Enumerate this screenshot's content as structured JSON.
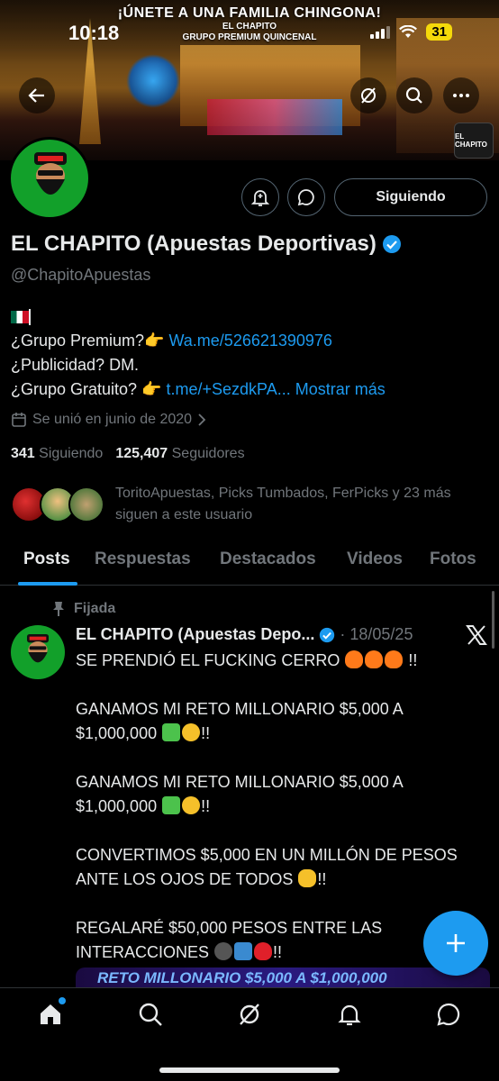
{
  "status_bar": {
    "time": "10:18",
    "battery": "31"
  },
  "banner": {
    "promo_title": "¡ÚNETE A UNA FAMILIA CHINGONA!",
    "promo_line1": "EL CHAPITO",
    "promo_line2": "GRUPO PREMIUM QUINCENAL",
    "logo_text": "EL CHAPITO"
  },
  "header_icons": {
    "back": "arrow-left-icon",
    "grok": "grok-icon",
    "search": "search-icon",
    "more": "more-icon"
  },
  "profile": {
    "display_name": "EL CHAPITO (Apuestas Deportivas)",
    "verified": true,
    "handle": "@ChapitoApuestas",
    "follow_label": "Siguiendo",
    "bio": {
      "line1_prefix": "¿Grupo Premium?👉 ",
      "line1_link": "Wa.me/526621390976",
      "line2": "¿Publicidad? DM.",
      "line3_prefix": "¿Grupo Gratuito? 👉 ",
      "line3_link": "t.me/+SezdkPA...",
      "show_more": "Mostrar más"
    },
    "joined": "Se unió en junio de 2020",
    "following_count": "341",
    "following_label": "Siguiendo",
    "followers_count": "125,407",
    "followers_label": "Seguidores",
    "followed_by": "ToritoApuestas, Picks Tumbados, FerPicks y 23 más siguen a este usuario"
  },
  "tabs": [
    {
      "label": "Posts",
      "active": true
    },
    {
      "label": "Respuestas",
      "active": false
    },
    {
      "label": "Destacados",
      "active": false
    },
    {
      "label": "Videos",
      "active": false
    },
    {
      "label": "Fotos",
      "active": false
    }
  ],
  "post": {
    "pinned_label": "Fijada",
    "author": "EL CHAPITO (Apuestas Depo...",
    "separator": "·",
    "date": "18/05/25",
    "p1": "SE PRENDIÓ EL FUCKING CERRO",
    "p1_end": " !!",
    "p2": "GANAMOS MI RETO MILLONARIO $5,000 A $1,000,000",
    "p2_end": "!!",
    "p3": "GANAMOS MI RETO MILLONARIO $5,000 A $1,000,000",
    "p3_end": "!!",
    "p4": "CONVERTIMOS $5,000 EN UN MILLÓN DE PESOS ANTE LOS OJOS DE TODOS",
    "p4_end": "!!",
    "p5": "REGALARÉ $50,000 PESOS ENTRE LAS INTERACCIONES",
    "p5_end": "!!",
    "media_text": "RETO MILLONARIO $5,000 A $1,000,000"
  },
  "colors": {
    "accent": "#1d9bf0",
    "background": "#000000",
    "muted": "#71767b",
    "avatar_green": "#12a02a"
  },
  "nav": [
    "home-icon",
    "search-icon",
    "grok-icon",
    "notifications-icon",
    "messages-icon"
  ]
}
